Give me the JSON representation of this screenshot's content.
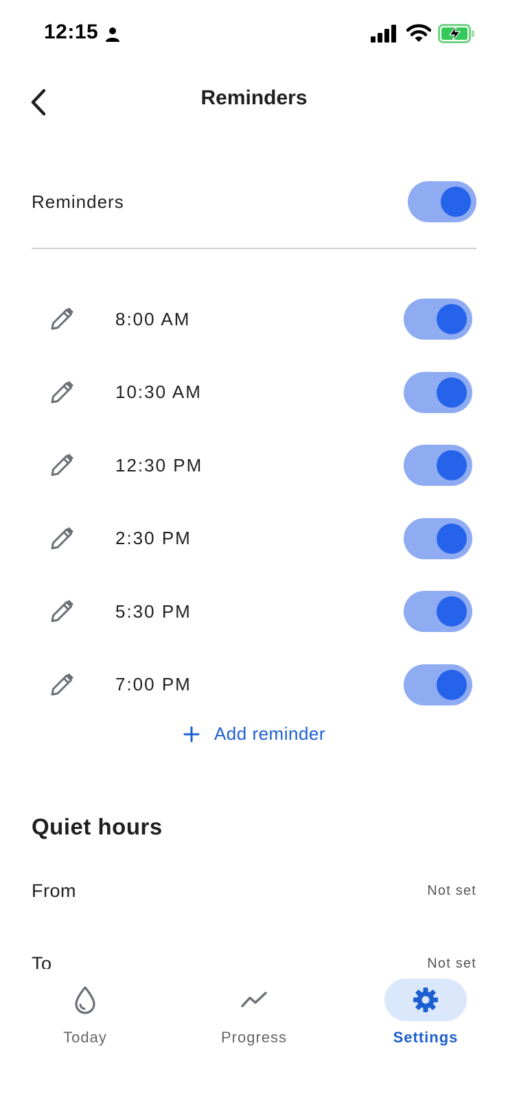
{
  "status_bar": {
    "time": "12:15"
  },
  "header": {
    "title": "Reminders",
    "back_icon": "chevron-left-icon"
  },
  "master": {
    "label": "Reminders",
    "enabled": true
  },
  "reminders": [
    {
      "time": "8:00 AM",
      "enabled": true
    },
    {
      "time": "10:30 AM",
      "enabled": true
    },
    {
      "time": "12:30 PM",
      "enabled": true
    },
    {
      "time": "2:30 PM",
      "enabled": true
    },
    {
      "time": "5:30 PM",
      "enabled": true
    },
    {
      "time": "7:00 PM",
      "enabled": true
    }
  ],
  "add_reminder": {
    "label": "Add reminder"
  },
  "quiet_hours": {
    "title": "Quiet hours",
    "from": {
      "label": "From",
      "value": "Not set"
    },
    "to": {
      "label": "To",
      "value": "Not set"
    }
  },
  "nav": {
    "items": [
      {
        "label": "Today",
        "icon": "water-drop-icon"
      },
      {
        "label": "Progress",
        "icon": "trend-line-icon"
      },
      {
        "label": "Settings",
        "icon": "gear-icon",
        "active": true
      }
    ]
  },
  "colors": {
    "accent": "#2563eb",
    "toggle_track": "#8fabf2",
    "link": "#1d5fd1",
    "active_nav_bg": "#dbe7fb",
    "battery_green": "#34c759"
  }
}
